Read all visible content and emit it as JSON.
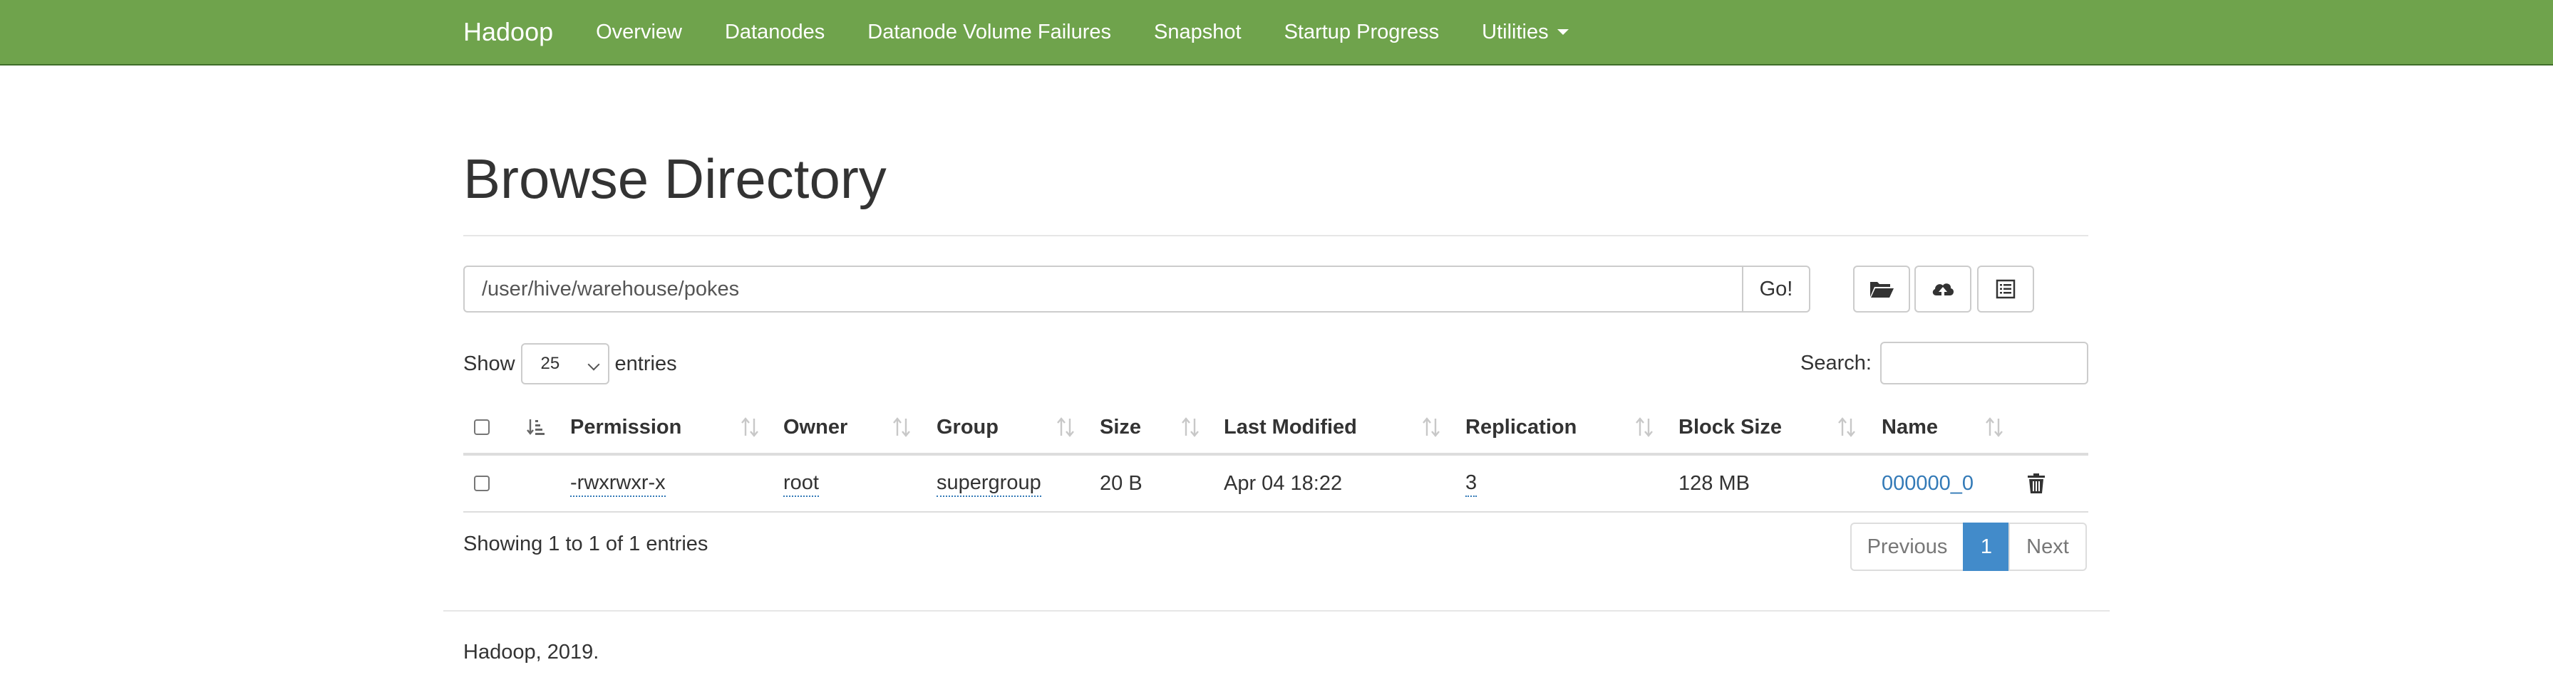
{
  "navbar": {
    "brand": "Hadoop",
    "items": [
      "Overview",
      "Datanodes",
      "Datanode Volume Failures",
      "Snapshot",
      "Startup Progress",
      "Utilities"
    ],
    "bg_color": "#6fa34c"
  },
  "page": {
    "title": "Browse Directory"
  },
  "path_bar": {
    "value": "/user/hive/warehouse/pokes",
    "go_label": "Go!",
    "icons": [
      "folder-open-icon",
      "cloud-upload-icon",
      "list-alt-icon"
    ]
  },
  "entries": {
    "show_label": "Show",
    "selected": "25",
    "entries_label": "entries"
  },
  "search": {
    "label": "Search:",
    "value": ""
  },
  "table": {
    "headers": [
      "Permission",
      "Owner",
      "Group",
      "Size",
      "Last Modified",
      "Replication",
      "Block Size",
      "Name"
    ],
    "rows": [
      {
        "permission": "-rwxrwxr-x",
        "owner": "root",
        "group": "supergroup",
        "size": "20 B",
        "last_modified": "Apr 04 18:22",
        "replication": "3",
        "block_size": "128 MB",
        "name": "000000_0"
      }
    ]
  },
  "info": "Showing 1 to 1 of 1 entries",
  "pagination": {
    "previous": "Previous",
    "current": "1",
    "next": "Next",
    "active_color": "#428bca"
  },
  "footer": "Hadoop, 2019."
}
